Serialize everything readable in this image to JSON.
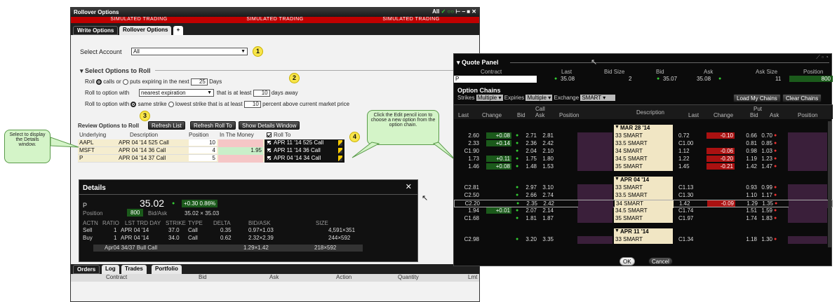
{
  "window": {
    "title": "Rollover Options",
    "indicators": "All",
    "sim": [
      "SIMULATED TRADING",
      "SIMULATED TRADING",
      "SIMULATED TRADING"
    ]
  },
  "tabs": [
    "Write Options",
    "Rollover Options",
    "+"
  ],
  "account": {
    "label": "Select Account",
    "value": "All"
  },
  "section": {
    "title": "Select Options to Roll"
  },
  "roll": {
    "roll": "Roll",
    "calls": "calls",
    "or": "or",
    "puts": "puts",
    "expiring": "expiring in the next",
    "days_value": "25",
    "days": "Days"
  },
  "roll_to1": {
    "label": "Roll to option with",
    "select": "nearest expiration",
    "that": "that is at least",
    "value": "10",
    "days_away": "days away"
  },
  "roll_to2": {
    "label": "Roll to option with",
    "same": "same strike",
    "lowest": "lowest strike that is at least",
    "value": "10",
    "pct": "percent above current market price"
  },
  "review": {
    "label": "Review Options to Roll",
    "refresh": "Refresh List",
    "refresh_to": "Refresh Roll To",
    "show_details": "Show Details Window"
  },
  "grid": {
    "headers": [
      "Underlying",
      "Description",
      "Position",
      "In The Money",
      "Roll To"
    ],
    "rows": [
      {
        "u": "AAPL",
        "d": "APR 04 '14 525 Call",
        "p": "10",
        "itm": "",
        "rt": "APR 11 '14 525 Call"
      },
      {
        "u": "MSFT",
        "d": "APR 04 '14 36 Call",
        "p": "4",
        "itm": "1.95",
        "rt": "APR 11 '14 36 Call"
      },
      {
        "u": "P",
        "d": "APR 04 '14 37 Call",
        "p": "5",
        "itm": "",
        "rt": "APR 04 '14 34 Call"
      }
    ]
  },
  "callouts": {
    "c1": "1",
    "c2": "2",
    "c3": "3",
    "c4": "4",
    "left": "Select to display the Details window.",
    "right": "Click the Edit pencil icon to choose a new option from the option chain."
  },
  "details": {
    "title": "Details",
    "sym": "P",
    "price": "35.02",
    "change": "+0.30 0.86%",
    "pos_label": "Position",
    "pos": "800",
    "bidask_label": "Bid/Ask",
    "bidask": "35.02 × 35.03",
    "headers": [
      "ACTN",
      "RATIO",
      "LST TRD DAY",
      "STRIKE",
      "TYPE",
      "DELTA",
      "BID/ASK",
      "SIZE"
    ],
    "rows": [
      {
        "a": "Sell",
        "r": "1",
        "l": "APR 04 '14",
        "s": "37.0",
        "t": "Call",
        "d": "0.35",
        "ba": "0.97×1.03",
        "sz": "4,591×351"
      },
      {
        "a": "Buy",
        "r": "1",
        "l": "APR 04 '14",
        "s": "34.0",
        "t": "Call",
        "d": "0.62",
        "ba": "2.32×2.39",
        "sz": "244×592"
      }
    ],
    "combo": {
      "name": "Apr04 34/37 Bull Call",
      "ba": "1.29×1.42",
      "sz": "218×592"
    }
  },
  "bottom_tabs": [
    "Orders",
    "Log",
    "Trades",
    "Portfolio"
  ],
  "orders_headers": [
    "Contract",
    "Bid",
    "Ask",
    "Action",
    "Quantity",
    "Lmt"
  ],
  "quote": {
    "title": "Quote Panel",
    "headers": [
      "Contract",
      "Last",
      "Bid Size",
      "Bid",
      "Ask",
      "Ask Size",
      "Position"
    ],
    "row": {
      "contract": "P",
      "last": "35.08",
      "bidsize": "2",
      "bid": "35.07",
      "ask": "35.08",
      "asksize": "11",
      "position": "800"
    },
    "chains_title": "Option Chains",
    "strikes": "Strikes",
    "strikes_val": "Multiple",
    "expiries": "Expiries",
    "expiries_val": "Multiple",
    "exchange": "Exchange",
    "exchange_val": "SMART",
    "load": "Load My Chains",
    "clear": "Clear Chains",
    "call": "Call",
    "put": "Put",
    "description": "Description",
    "call_headers": [
      "Last",
      "Change",
      "Bid",
      "Ask",
      "Position"
    ],
    "put_headers": [
      "Last",
      "Change",
      "Bid",
      "Ask",
      "Position"
    ],
    "ok": "OK",
    "cancel": "Cancel"
  },
  "chain": [
    {
      "hdr": "MAR 28 '14"
    },
    {
      "cl": "2.60",
      "cc": "+0.08",
      "cb": "2.71",
      "ca": "2.81",
      "d": "33 SMART",
      "pl": "0.72",
      "pc": "-0.10",
      "pb": "0.66",
      "pa": "0.70"
    },
    {
      "cl": "2.33",
      "cc": "+0.14",
      "cb": "2.36",
      "ca": "2.42",
      "d": "33.5 SMART",
      "pl": "C1.00",
      "pc": "",
      "pb": "0.81",
      "pa": "0.85"
    },
    {
      "cl": "C1.90",
      "cc": "",
      "cb": "2.04",
      "ca": "2.10",
      "d": "34 SMART",
      "pl": "1.12",
      "pc": "-0.06",
      "pb": "0.98",
      "pa": "1.03"
    },
    {
      "cl": "1.73",
      "cc": "+0.11",
      "cb": "1.75",
      "ca": "1.80",
      "d": "34.5 SMART",
      "pl": "1.22",
      "pc": "-0.20",
      "pb": "1.19",
      "pa": "1.23"
    },
    {
      "cl": "1.46",
      "cc": "+0.08",
      "cb": "1.48",
      "ca": "1.53",
      "d": "35 SMART",
      "pl": "1.45",
      "pc": "-0.21",
      "pb": "1.42",
      "pa": "1.47"
    },
    {
      "hdr": "APR 04 '14"
    },
    {
      "cl": "C2.81",
      "cc": "",
      "cb": "2.97",
      "ca": "3.10",
      "d": "33 SMART",
      "pl": "C1.13",
      "pc": "",
      "pb": "0.93",
      "pa": "0.99"
    },
    {
      "cl": "C2.50",
      "cc": "",
      "cb": "2.66",
      "ca": "2.74",
      "d": "33.5 SMART",
      "pl": "C1.30",
      "pc": "",
      "pb": "1.10",
      "pa": "1.17"
    },
    {
      "cl": "C2.20",
      "cc": "",
      "cb": "2.35",
      "ca": "2.42",
      "d": "34 SMART",
      "pl": "1.42",
      "pc": "-0.09",
      "pb": "1.29",
      "pa": "1.35"
    },
    {
      "cl": "1.94",
      "cc": "+0.01",
      "cb": "2.07",
      "ca": "2.14",
      "d": "34.5 SMART",
      "pl": "C1.74",
      "pc": "",
      "pb": "1.51",
      "pa": "1.59"
    },
    {
      "cl": "C1.68",
      "cc": "",
      "cb": "1.81",
      "ca": "1.87",
      "d": "35 SMART",
      "pl": "C1.97",
      "pc": "",
      "pb": "1.74",
      "pa": "1.83"
    },
    {
      "hdr": "APR 11 '14"
    },
    {
      "cl": "C2.98",
      "cc": "",
      "cb": "3.20",
      "ca": "3.35",
      "d": "33 SMART",
      "pl": "C1.34",
      "pc": "",
      "pb": "1.18",
      "pa": "1.30"
    }
  ]
}
